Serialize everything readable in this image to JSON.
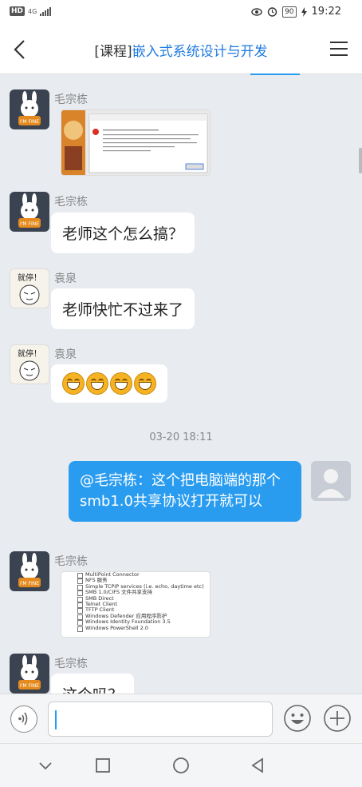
{
  "status": {
    "time": "19:22",
    "battery": "90",
    "network": "4G",
    "hd": "HD"
  },
  "header": {
    "title_prefix": "[课程]",
    "title": "嵌入式系统设计与开发"
  },
  "messages": [
    {
      "sender": "毛宗栋",
      "type": "image"
    },
    {
      "sender": "毛宗栋",
      "text": "老师这个怎么搞？"
    },
    {
      "sender": "袁泉",
      "text": "老师快忙不过来了"
    },
    {
      "sender": "袁泉",
      "type": "emoji"
    },
    {
      "sender": "毛宗栋",
      "type": "image"
    },
    {
      "sender": "毛宗栋",
      "text": "这个吗？"
    }
  ],
  "timestamp": "03-20 18:11",
  "outgoing": {
    "text": "@毛宗栋：这个把电脑端的那个smb1.0共享协议打开就可以"
  },
  "avatars": {
    "yq_text": "就停！",
    "mi_text": "I'M FINE"
  },
  "screenshot2": {
    "rows": [
      "MultiPoint Connector",
      "NFS 服务",
      "Simple TCPIP services (i.e. echo, daytime etc)",
      "SMB 1.0/CIFS 文件共享支持",
      "SMB Direct",
      "Telnet Client",
      "TFTP Client",
      "Windows Defender 应用程序防护",
      "Windows Identity Foundation 3.5",
      "Windows PowerShell 2.0"
    ]
  },
  "colors": {
    "accent": "#2a9cf0",
    "title_blue": "#1f7ae0"
  }
}
